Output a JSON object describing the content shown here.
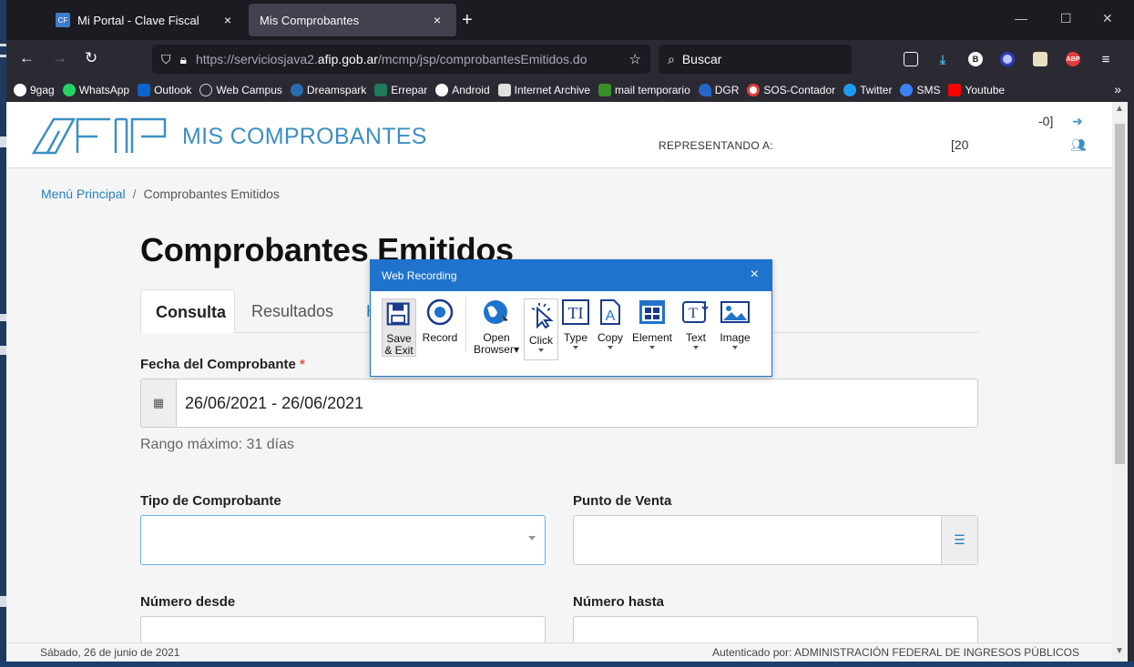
{
  "browser": {
    "tabs": [
      {
        "label": "Mi Portal - Clave Fiscal",
        "close": "×"
      },
      {
        "label": "Mis Comprobantes",
        "close": "×"
      }
    ],
    "new_tab": "+",
    "url_plain_start": "https://serviciosjava2.",
    "url_domain": "afip.gob.ar",
    "url_plain_end": "/mcmp/jsp/comprobantesEmitidos.do",
    "search_placeholder": "Buscar",
    "bookmarks": [
      {
        "label": "9gag",
        "color": "#ffffff"
      },
      {
        "label": "WhatsApp",
        "color": "#25d366"
      },
      {
        "label": "Outlook",
        "color": "#0a64c9"
      },
      {
        "label": "Web Campus",
        "color": "#d0d0d0"
      },
      {
        "label": "Dreamspark",
        "color": "#2b6cb0"
      },
      {
        "label": "Errepar",
        "color": "#1e7a5a"
      },
      {
        "label": "Android",
        "color": "#ffffff"
      },
      {
        "label": "Internet Archive",
        "color": "#e0e0e0"
      },
      {
        "label": "mail temporario",
        "color": "#3a8f2a"
      },
      {
        "label": "DGR",
        "color": "#2666c4"
      },
      {
        "label": "SOS-Contador",
        "color": "#e23c3c"
      },
      {
        "label": "Twitter",
        "color": "#1d9bf0"
      },
      {
        "label": "SMS",
        "color": "#3b82f6"
      },
      {
        "label": "Youtube",
        "color": "#ff0000"
      }
    ]
  },
  "header": {
    "logo_text": "AFIP",
    "title": "MIS COMPROBANTES",
    "representing_label": "REPRESENTANDO A:",
    "cuit_tail_1": "-0]",
    "cuit_tail_2": "[20"
  },
  "breadcrumb": {
    "home": "Menú Principal",
    "sep": "/",
    "current": "Comprobantes Emitidos"
  },
  "main": {
    "heading": "Comprobantes Emitidos",
    "tabs": [
      {
        "label": "Consulta"
      },
      {
        "label": "Resultados"
      },
      {
        "label": "H"
      }
    ],
    "fecha_label": "Fecha del Comprobante",
    "required_mark": "*",
    "fecha_value": "26/06/2021 - 26/06/2021",
    "fecha_help": "Rango máximo: 31 días",
    "tipo_label": "Tipo de Comprobante",
    "tipo_value": "",
    "punto_label": "Punto de Venta",
    "numero_desde_label": "Número desde",
    "numero_hasta_label": "Número hasta"
  },
  "footer": {
    "date": "Sábado, 26 de junio de 2021",
    "auth": "Autenticado por: ADMINISTRACIÓN FEDERAL DE INGRESOS PÚBLICOS"
  },
  "recorder": {
    "title": "Web Recording",
    "close": "×",
    "tools": {
      "save_line1": "Save",
      "save_line2": "& Exit",
      "record": "Record",
      "open_line1": "Open",
      "open_line2": "Browser",
      "click": "Click",
      "type": "Type",
      "copy": "Copy",
      "element": "Element",
      "text": "Text",
      "image": "Image"
    },
    "accent": "#1f73cc"
  }
}
